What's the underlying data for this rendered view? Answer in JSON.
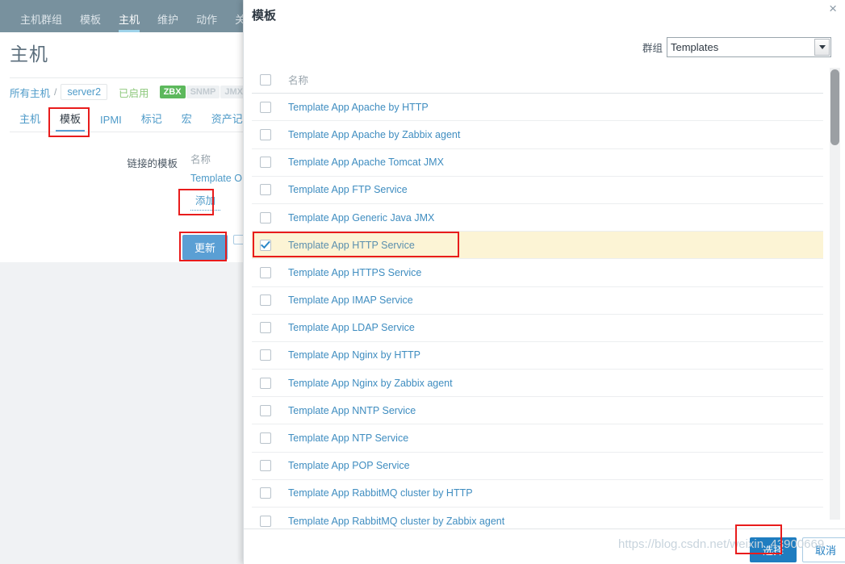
{
  "colors": {
    "nav_bg": "#78919e",
    "accent": "#4d9ac8",
    "primary_button": "#1f7dc0",
    "selected_row": "#fcf4d5",
    "annotation": "#e81c1c",
    "status_ok": "#5cb85c"
  },
  "nav": {
    "items": [
      {
        "label": "主机群组",
        "active": false
      },
      {
        "label": "模板",
        "active": false
      },
      {
        "label": "主机",
        "active": true
      },
      {
        "label": "维护",
        "active": false
      },
      {
        "label": "动作",
        "active": false
      },
      {
        "label": "关联",
        "active": false
      }
    ]
  },
  "page": {
    "title": "主机",
    "breadcrumb": {
      "root": "所有主机",
      "separator": "/",
      "current": "server2",
      "status": "已启用",
      "interfaces": [
        {
          "label": "ZBX",
          "enabled": true
        },
        {
          "label": "SNMP",
          "enabled": false
        },
        {
          "label": "JMX",
          "enabled": false
        }
      ]
    },
    "tabs": [
      {
        "label": "主机",
        "active": false
      },
      {
        "label": "模板",
        "active": true
      },
      {
        "label": "IPMI",
        "active": false
      },
      {
        "label": "标记",
        "active": false
      },
      {
        "label": "宏",
        "active": false
      },
      {
        "label": "资产记录",
        "active": false
      }
    ],
    "form": {
      "linked_templates_label": "链接的模板",
      "column_name": "名称",
      "linked_row": "Template O",
      "add_label": "添加"
    },
    "buttons": {
      "update": "更新",
      "secondary": ""
    }
  },
  "modal": {
    "title": "模板",
    "close_icon": "×",
    "group_label": "群组",
    "group_value": "Templates",
    "column_name": "名称",
    "rows": [
      {
        "name": "Template App Apache by HTTP",
        "checked": false
      },
      {
        "name": "Template App Apache by Zabbix agent",
        "checked": false
      },
      {
        "name": "Template App Apache Tomcat JMX",
        "checked": false
      },
      {
        "name": "Template App FTP Service",
        "checked": false
      },
      {
        "name": "Template App Generic Java JMX",
        "checked": false
      },
      {
        "name": "Template App HTTP Service",
        "checked": true
      },
      {
        "name": "Template App HTTPS Service",
        "checked": false
      },
      {
        "name": "Template App IMAP Service",
        "checked": false
      },
      {
        "name": "Template App LDAP Service",
        "checked": false
      },
      {
        "name": "Template App Nginx by HTTP",
        "checked": false
      },
      {
        "name": "Template App Nginx by Zabbix agent",
        "checked": false
      },
      {
        "name": "Template App NNTP Service",
        "checked": false
      },
      {
        "name": "Template App NTP Service",
        "checked": false
      },
      {
        "name": "Template App POP Service",
        "checked": false
      },
      {
        "name": "Template App RabbitMQ cluster by HTTP",
        "checked": false
      },
      {
        "name": "Template App RabbitMQ cluster by Zabbix agent",
        "checked": false
      }
    ],
    "footer": {
      "select": "选择",
      "cancel": "取消"
    }
  },
  "watermark": "https://blog.csdn.net/weixin_43900669"
}
